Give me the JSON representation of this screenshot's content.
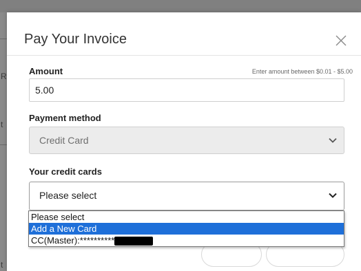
{
  "modal": {
    "title": "Pay Your Invoice"
  },
  "amount": {
    "label": "Amount",
    "hint": "Enter amount between $0.01 - $5.00",
    "value": "5.00"
  },
  "payment_method": {
    "label": "Payment method",
    "selected": "Credit Card"
  },
  "credit_cards": {
    "label": "Your credit cards",
    "selected": "Please select",
    "options": [
      "Please select",
      "Add a New Card",
      "CC(Master):**********"
    ],
    "highlighted_index": 1
  },
  "colors": {
    "highlight": "#1e6fd9",
    "disabled_bg": "#ececec"
  }
}
